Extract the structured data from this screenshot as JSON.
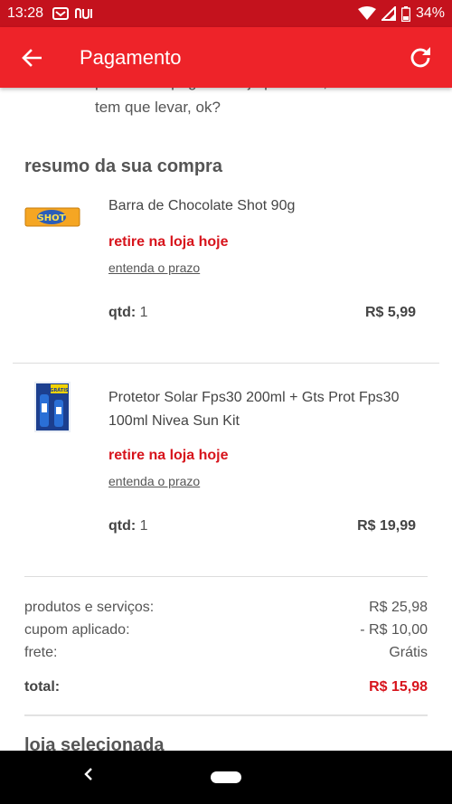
{
  "status_bar": {
    "time": "13:28",
    "battery": "34%",
    "icons": [
      "notification-icon",
      "nubank-icon",
      "wifi-icon",
      "signal-icon",
      "battery-icon"
    ]
  },
  "app_bar": {
    "title": "Pagamento",
    "back_icon": "arrow-left-icon",
    "refresh_icon": "refresh-icon",
    "background": "#ee2329"
  },
  "intro": {
    "line1": "pessoa for pegar na loja por você, também",
    "line2": "tem que levar, ok?"
  },
  "summary_title": "resumo da sua compra",
  "items": [
    {
      "name": "Barra de Chocolate Shot 90g",
      "pickup": "retire na loja hoje",
      "deadline_link": "entenda o prazo",
      "qty_label": "qtd:",
      "qty": "1",
      "price": "R$ 5,99",
      "thumb_label": "SHOT"
    },
    {
      "name": "Protetor Solar Fps30 200ml + Gts Prot Fps30 100ml Nivea Sun Kit",
      "pickup": "retire na loja hoje",
      "deadline_link": "entenda o prazo",
      "qty_label": "qtd:",
      "qty": "1",
      "price": "R$ 19,99",
      "thumb_label": "GRÁTIS"
    }
  ],
  "totals": {
    "products_label": "produtos e serviços:",
    "products_value": "R$ 25,98",
    "coupon_label": "cupom aplicado:",
    "coupon_value": "- R$ 10,00",
    "shipping_label": "frete:",
    "shipping_value": "Grátis",
    "total_label": "total:",
    "total_value": "R$ 15,98"
  },
  "next_section_title": "loja selecionada",
  "colors": {
    "brand_red": "#ee2329",
    "status_red": "#c4121d",
    "accent_text_red": "#d7141c"
  }
}
